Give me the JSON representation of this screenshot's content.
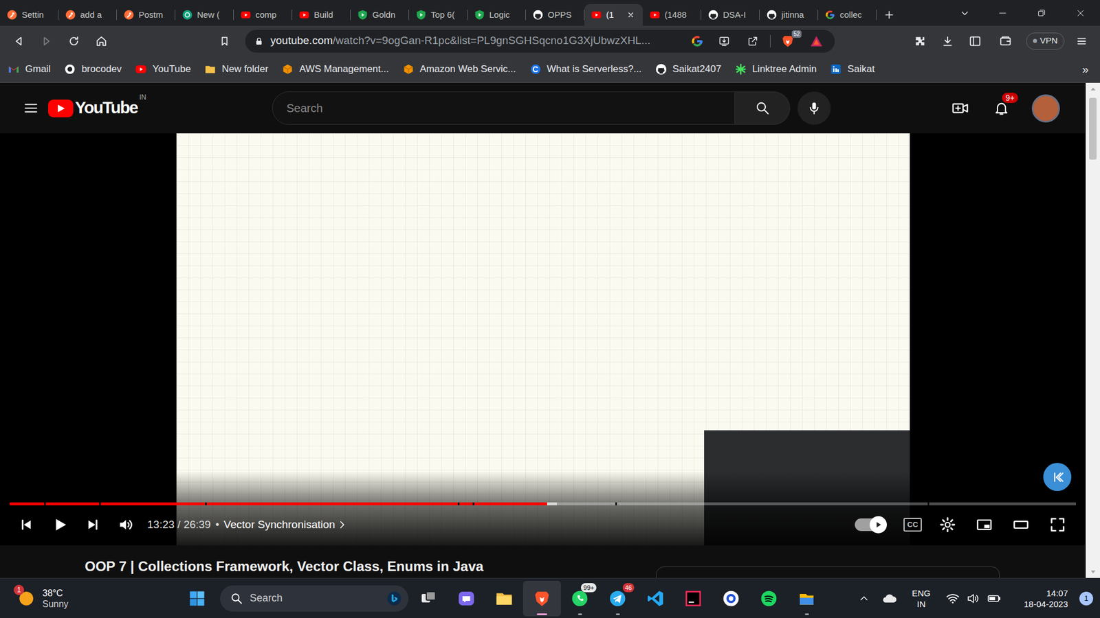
{
  "browser": {
    "tabs": [
      {
        "label": "Settin",
        "kind": "postman",
        "selected": false
      },
      {
        "label": "add a",
        "kind": "postman",
        "selected": false
      },
      {
        "label": "Postm",
        "kind": "postman",
        "selected": false
      },
      {
        "label": "New (",
        "kind": "chatgpt",
        "selected": false
      },
      {
        "label": "comp",
        "kind": "youtube",
        "selected": false
      },
      {
        "label": "Build",
        "kind": "youtube",
        "selected": false
      },
      {
        "label": "Goldn",
        "kind": "shield",
        "selected": false
      },
      {
        "label": "Top 6(",
        "kind": "shield",
        "selected": false
      },
      {
        "label": "Logic",
        "kind": "shield",
        "selected": false
      },
      {
        "label": "OPPS",
        "kind": "github",
        "selected": false
      },
      {
        "label": "(1",
        "kind": "youtube",
        "selected": true
      },
      {
        "label": "(1488",
        "kind": "youtube",
        "selected": false
      },
      {
        "label": "DSA-I",
        "kind": "github",
        "selected": false
      },
      {
        "label": "jitinna",
        "kind": "github",
        "selected": false
      },
      {
        "label": "collec",
        "kind": "google",
        "selected": false
      }
    ],
    "address": {
      "host": "youtube.com",
      "path": "/watch?v=9ogGan-R1pc&list=PL9gnSGHSqcno1G3XjUbwzXHL..."
    },
    "shields_count": "52",
    "vpn": {
      "label": "VPN",
      "connected": false
    },
    "bookmarks": [
      {
        "label": "Gmail",
        "kind": "gmail"
      },
      {
        "label": "brocodev",
        "kind": "brocodev"
      },
      {
        "label": "YouTube",
        "kind": "youtube"
      },
      {
        "label": "New folder",
        "kind": "folder"
      },
      {
        "label": "AWS Management...",
        "kind": "aws"
      },
      {
        "label": "Amazon Web Servic...",
        "kind": "aws"
      },
      {
        "label": "What is Serverless?...",
        "kind": "serverless"
      },
      {
        "label": "Saikat2407",
        "kind": "github"
      },
      {
        "label": "Linktree Admin",
        "kind": "linktree"
      },
      {
        "label": "Saikat",
        "kind": "linkedin"
      }
    ],
    "bookmarks_more": "»"
  },
  "youtube": {
    "logo": "YouTube",
    "region": "IN",
    "search_placeholder": "Search",
    "notifications": "9+"
  },
  "player": {
    "played": 0.504,
    "buffered": 0.513,
    "chapter_ends": [
      0.032,
      0.084,
      0.183,
      0.42,
      0.434,
      0.568,
      0.861
    ],
    "time": "13:23 / 26:39",
    "separator": "•",
    "chapter": "Vector Synchronisation",
    "autoplay": true,
    "captions_label": "CC",
    "captions": false
  },
  "video": {
    "title": "OOP 7 | Collections Framework, Vector Class, Enums in Java"
  },
  "taskbar": {
    "weather": {
      "temperature": "38°C",
      "condition": "Sunny",
      "badge": "1"
    },
    "search_placeholder": "Search",
    "apps": [
      {
        "kind": "taskview",
        "running": false,
        "active": false
      },
      {
        "kind": "chat",
        "running": false,
        "active": false
      },
      {
        "kind": "explorer",
        "running": false,
        "active": false
      },
      {
        "kind": "brave",
        "running": true,
        "active": true
      },
      {
        "kind": "whatsapp",
        "badge": "99+",
        "running": true,
        "active": false
      },
      {
        "kind": "telegram",
        "badge": "46",
        "running": true,
        "active": false
      },
      {
        "kind": "vscode",
        "running": false,
        "active": false
      },
      {
        "kind": "intellij",
        "running": false,
        "active": false
      },
      {
        "kind": "circleapp",
        "running": false,
        "active": false
      },
      {
        "kind": "spotify",
        "running": false,
        "active": false
      },
      {
        "kind": "notes",
        "running": true,
        "active": false
      }
    ],
    "language": {
      "line1": "ENG",
      "line2": "IN"
    },
    "time": "14:07",
    "date": "18-04-2023",
    "notifications": "1"
  }
}
